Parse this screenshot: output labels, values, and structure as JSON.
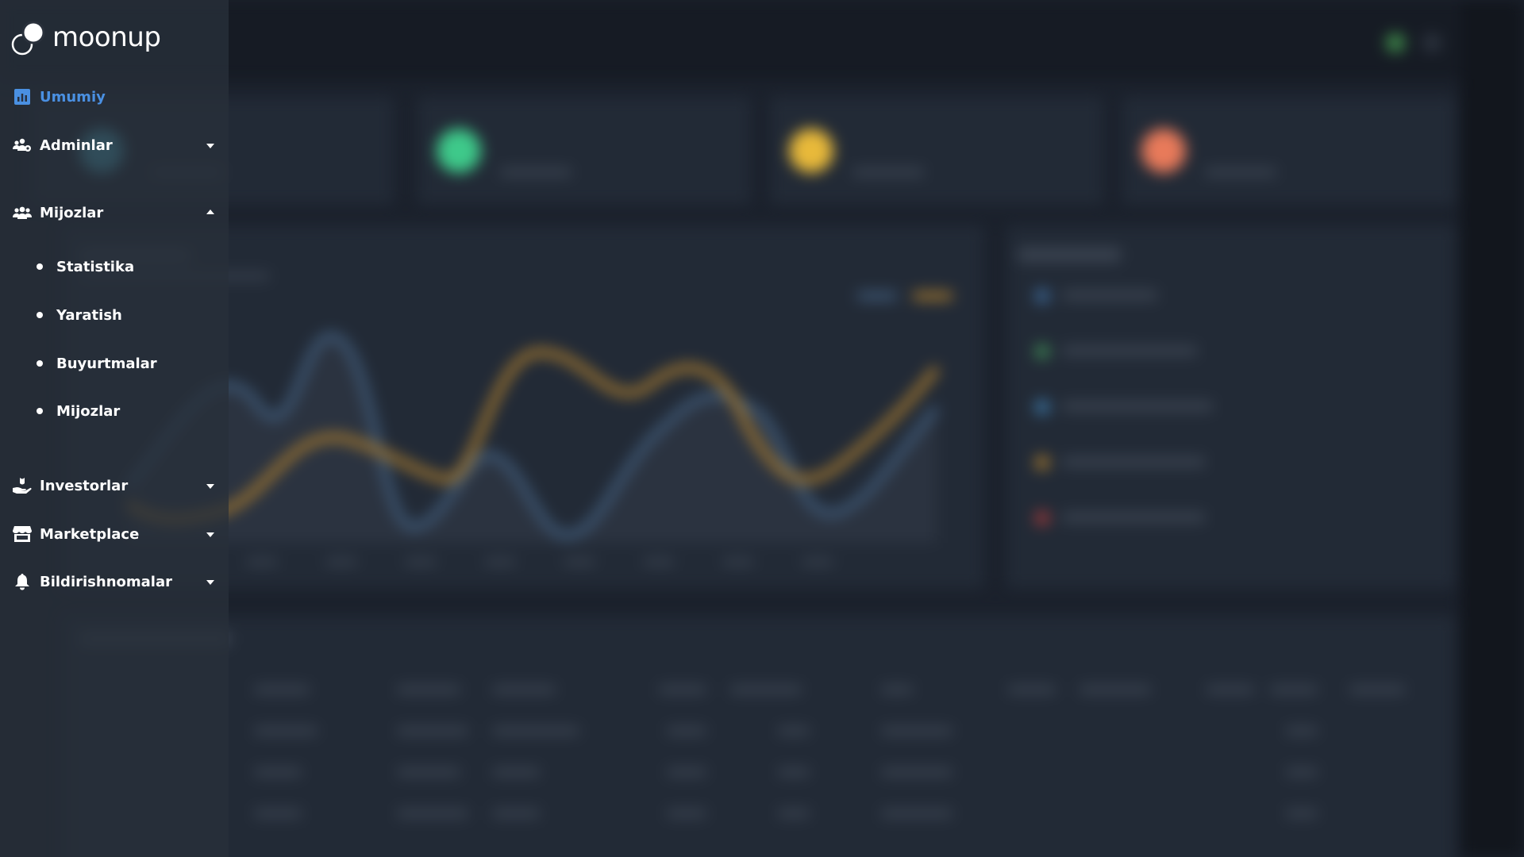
{
  "app": {
    "brand": "moonup",
    "accent_color": "#4a90e2"
  },
  "sidebar": {
    "items": [
      {
        "label": "Umumiy",
        "icon": "bar-chart-icon",
        "active": true
      },
      {
        "label": "Adminlar",
        "icon": "users-cog-icon",
        "expanded": false
      },
      {
        "label": "Mijozlar",
        "icon": "users-icon",
        "expanded": true,
        "children": [
          {
            "label": "Statistika"
          },
          {
            "label": "Yaratish"
          },
          {
            "label": "Buyurtmalar"
          },
          {
            "label": "Mijozlar"
          }
        ]
      },
      {
        "label": "Investorlar",
        "icon": "hand-holding-icon",
        "expanded": false
      },
      {
        "label": "Marketplace",
        "icon": "store-icon",
        "expanded": false
      },
      {
        "label": "Bildirishnomalar",
        "icon": "bell-icon",
        "expanded": false
      }
    ]
  },
  "background": {
    "stat_cards": [
      {
        "value": "",
        "icon": "user-icon",
        "color": "#4fb3c9"
      },
      {
        "value": "",
        "icon": "money-icon",
        "color": "#3ec98a"
      },
      {
        "value": "",
        "icon": "coins-icon",
        "color": "#e8b93a"
      },
      {
        "value": "",
        "icon": "wallet-icon",
        "color": "#e87a5a"
      }
    ],
    "series_colors": [
      "#3f5a78",
      "#a77a2e"
    ],
    "timeline_colors": [
      "#3d6a9a",
      "#3f8a55",
      "#3d7aaa",
      "#a77a2e",
      "#a33a3a"
    ]
  }
}
